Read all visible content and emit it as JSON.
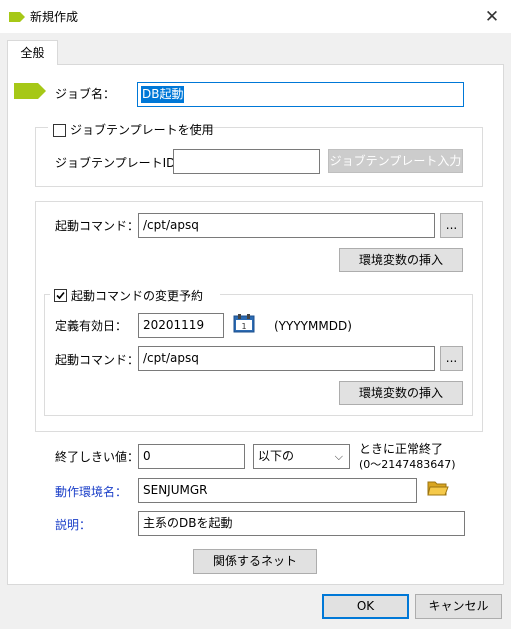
{
  "window": {
    "title": "新規作成"
  },
  "tabs": [
    {
      "label": "全般"
    }
  ],
  "job": {
    "name_label": "ジョブ名：",
    "name_value": "DB起動"
  },
  "template": {
    "checkbox_label": "ジョブテンプレートを使用",
    "checked": false,
    "id_label": "ジョブテンプレートID：",
    "id_value": "",
    "button_label": "ジョブテンプレート入力"
  },
  "command": {
    "label": "起動コマンド：",
    "value": "/cpt/apsq",
    "browse_label": "...",
    "env_button_label": "環境変数の挿入"
  },
  "schedule": {
    "checkbox_label": "起動コマンドの変更予約",
    "checked": true,
    "date_label": "定義有効日：",
    "date_value": "20201119",
    "date_format": "(YYYYMMDD)",
    "command_label": "起動コマンド：",
    "command_value": "/cpt/apsq",
    "browse_label": "...",
    "env_button_label": "環境変数の挿入"
  },
  "threshold": {
    "label": "終了しきい値：",
    "value": "0",
    "condition_selected": "以下の",
    "suffix": "ときに正常終了",
    "range": "(0〜2147483647)"
  },
  "environment": {
    "label": "動作環境名：",
    "value": "SENJUMGR"
  },
  "description": {
    "label": "説明：",
    "value": "主系のDBを起動"
  },
  "related_button_label": "関係するネット",
  "footer": {
    "ok_label": "OK",
    "cancel_label": "キャンセル"
  },
  "colors": {
    "accent": "#0078d7",
    "job_marker": "#a6c817",
    "link_label": "#1a3ec8"
  }
}
